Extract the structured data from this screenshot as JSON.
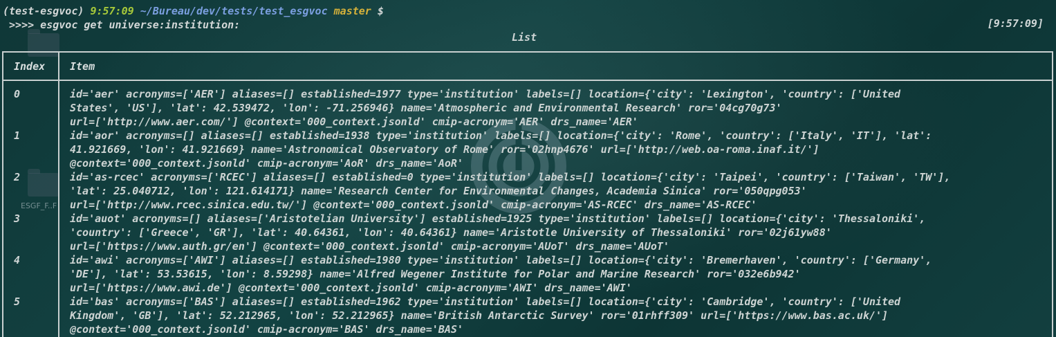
{
  "prompt": {
    "env": "(test-esgvoc)",
    "time": "9:57:09",
    "path": "~/Bureau/dev/tests/test_esgvoc",
    "branch": "master",
    "symbol": "$"
  },
  "command": {
    "text": " >>>> esgvoc get universe:institution:",
    "clock": "[9:57:09]"
  },
  "table": {
    "title": "List",
    "headers": {
      "index": "Index",
      "item": "Item"
    },
    "rows": [
      {
        "index": "0",
        "lines": [
          "id='aer' acronyms=['AER'] aliases=[] established=1977 type='institution' labels=[] location={'city': 'Lexington', 'country': ['United",
          "States', 'US'], 'lat': 42.539472, 'lon': -71.256946} name='Atmospheric and Environmental Research' ror='04cg70g73'",
          "url=['http://www.aer.com/'] @context='000_context.jsonld' cmip-acronym='AER' drs_name='AER'"
        ]
      },
      {
        "index": "1",
        "lines": [
          "id='aor' acronyms=[] aliases=[] established=1938 type='institution' labels=[] location={'city': 'Rome', 'country': ['Italy', 'IT'], 'lat':",
          "41.921669, 'lon': 41.921669} name='Astronomical Observatory of Rome' ror='02hnp4676' url=['http://web.oa-roma.inaf.it/']",
          "@context='000_context.jsonld' cmip-acronym='AoR' drs_name='AoR'"
        ]
      },
      {
        "index": "2",
        "lines": [
          "id='as-rcec' acronyms=['RCEC'] aliases=[] established=0 type='institution' labels=[] location={'city': 'Taipei', 'country': ['Taiwan', 'TW'],",
          "'lat': 25.040712, 'lon': 121.614171} name='Research Center for Environmental Changes, Academia Sinica' ror='050qpg053'",
          "url=['http://www.rcec.sinica.edu.tw/'] @context='000_context.jsonld' cmip-acronym='AS-RCEC' drs_name='AS-RCEC'"
        ]
      },
      {
        "index": "3",
        "lines": [
          "id='auot' acronyms=[] aliases=['Aristotelian University'] established=1925 type='institution' labels=[] location={'city': 'Thessaloniki',",
          "'country': ['Greece', 'GR'], 'lat': 40.64361, 'lon': 40.64361} name='Aristotle University of Thessaloniki' ror='02j61yw88'",
          "url=['https://www.auth.gr/en'] @context='000_context.jsonld' cmip-acronym='AUoT' drs_name='AUoT'"
        ]
      },
      {
        "index": "4",
        "lines": [
          "id='awi' acronyms=['AWI'] aliases=[] established=1980 type='institution' labels=[] location={'city': 'Bremerhaven', 'country': ['Germany',",
          "'DE'], 'lat': 53.53615, 'lon': 8.59298} name='Alfred Wegener Institute for Polar and Marine Research' ror='032e6b942'",
          "url=['https://www.awi.de'] @context='000_context.jsonld' cmip-acronym='AWI' drs_name='AWI'"
        ]
      },
      {
        "index": "5",
        "lines": [
          "id='bas' acronyms=['BAS'] aliases=[] established=1962 type='institution' labels=[] location={'city': 'Cambridge', 'country': ['United",
          "Kingdom', 'GB'], 'lat': 52.212965, 'lon': 52.212965} name='British Antarctic Survey' ror='01rhff309' url=['https://www.bas.ac.uk/']",
          "@context='000_context.jsonld' cmip-acronym='BAS' drs_name='BAS'"
        ]
      }
    ]
  },
  "desktop": {
    "folder_label": "ESGF_F..F"
  }
}
